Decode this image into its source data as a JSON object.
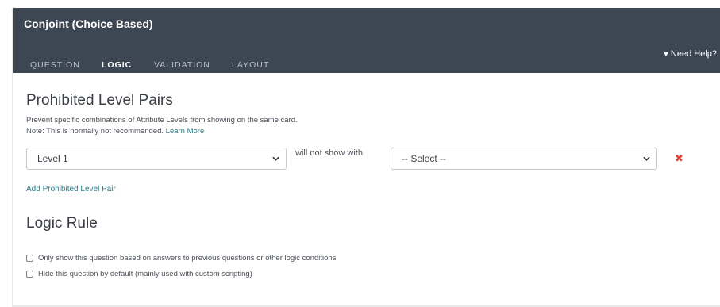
{
  "header": {
    "title": "Conjoint (Choice Based)",
    "tabs": [
      {
        "label": "QUESTION"
      },
      {
        "label": "LOGIC"
      },
      {
        "label": "VALIDATION"
      },
      {
        "label": "LAYOUT"
      }
    ],
    "active_tab": "LOGIC",
    "help_label": "Need Help?"
  },
  "prohibited": {
    "title": "Prohibited Level Pairs",
    "desc_line1": "Prevent specific combinations of Attribute Levels from showing on the same card.",
    "desc_line2_prefix": "Note: This is normally not recommended.",
    "learn_more": "Learn More",
    "pair": {
      "level_value": "Level 1",
      "separator": "will not show with",
      "select_value": "-- Select --"
    },
    "add_label": "Add Prohibited Level Pair"
  },
  "logic": {
    "title": "Logic Rule",
    "options": [
      {
        "label": "Only show this question based on answers to previous questions or other logic conditions"
      },
      {
        "label": "Hide this question by default (mainly used with custom scripting)"
      }
    ]
  },
  "colors": {
    "header_bg": "#3d4653",
    "link": "#2b7c86",
    "remove": "#e0443b"
  }
}
